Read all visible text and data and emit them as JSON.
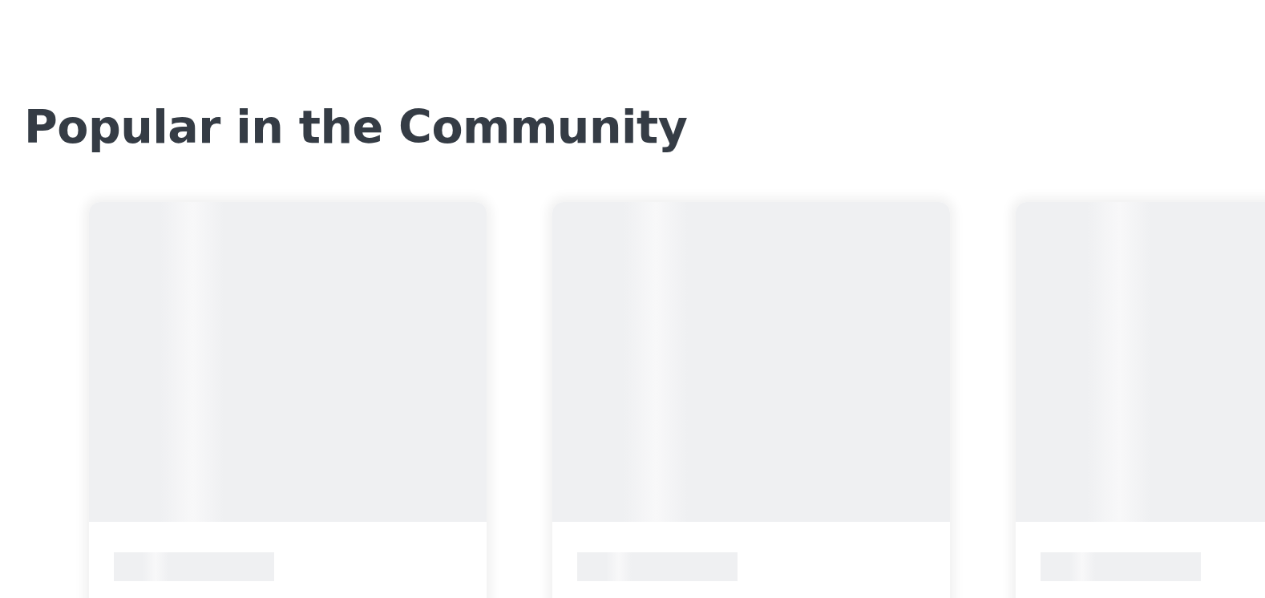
{
  "section": {
    "title": "Popular in the Community"
  },
  "cards": [
    {
      "kind": "skeleton"
    },
    {
      "kind": "skeleton"
    },
    {
      "kind": "skeleton"
    }
  ]
}
